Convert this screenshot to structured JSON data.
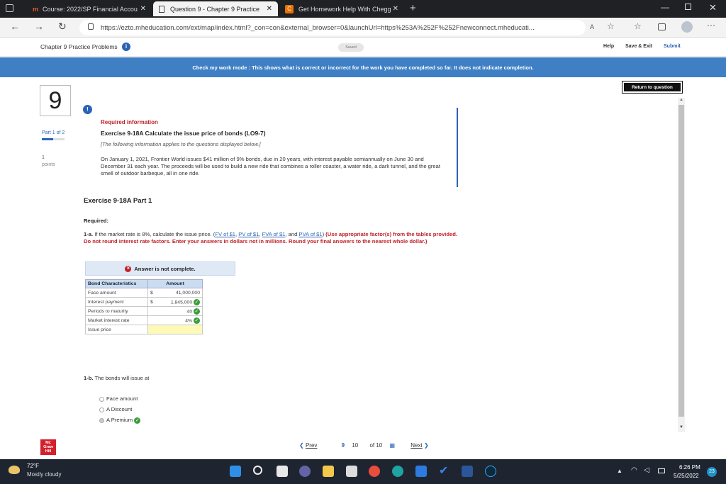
{
  "browser": {
    "tabs": [
      {
        "label": "Course: 2022/SP Financial Accou",
        "icon": "mheducation-icon"
      },
      {
        "label": "Question 9 - Chapter 9 Practice",
        "icon": "page-icon"
      },
      {
        "label": "Get Homework Help With Chegg",
        "icon": "chegg-icon"
      }
    ],
    "url": "https://ezto.mheducation.com/ext/map/index.html?_con=con&external_browser=0&launchUrl=https%253A%252F%252Fnewconnect.mheducati..."
  },
  "header": {
    "title": "Chapter 9 Practice Problems",
    "saved": "Saved",
    "help": "Help",
    "save_exit": "Save & Exit",
    "submit": "Submit"
  },
  "banner": "Check my work mode : This shows what is correct or incorrect for the work you have completed so far. It does not indicate completion.",
  "return_button": "Return to question",
  "question": {
    "number": "9",
    "part": "Part 1 of 2",
    "points_value": "1",
    "points_label": "points",
    "required_info": "Required information",
    "exercise_title": "Exercise 9-18A Calculate the issue price of bonds (LO9-7)",
    "note": "[The following information applies to the questions displayed below.]",
    "scenario": "On January 1, 2021, Frontier World issues $41 million of 9% bonds, due in 20 years, with interest payable semiannually on June 30 and December 31 each year. The proceeds will be used to build a new ride that combines a roller coaster, a water ride, a dark tunnel, and the great smell of outdoor barbeque, all in one ride.",
    "part_title": "Exercise 9-18A Part 1",
    "required": "Required:",
    "q1a_prefix": "1-a.",
    "q1a_text": "If the market rate is 8%, calculate the issue price.",
    "links": [
      "FV of $1",
      "PV of $1",
      "FVA of $1",
      "PVA of $1"
    ],
    "q1a_instr": "(Use appropriate factor(s) from the tables provided. Do not round interest rate factors. Enter your answers in dollars not in millions. Round your final answers to the nearest whole dollar.)",
    "answer_status": "Answer is not complete.",
    "table": {
      "headers": [
        "Bond Characteristics",
        "Amount"
      ],
      "rows": [
        {
          "label": "Face amount",
          "currency": "$",
          "value": "41,000,000",
          "correct": false
        },
        {
          "label": "Interest payment",
          "currency": "$",
          "value": "1,845,000",
          "correct": true
        },
        {
          "label": "Periods to maturity",
          "currency": "",
          "value": "40",
          "correct": true
        },
        {
          "label": "Market interest rate",
          "currency": "",
          "value": "4%",
          "correct": true
        },
        {
          "label": "Issue price",
          "currency": "",
          "value": "",
          "correct": false
        }
      ]
    },
    "q1b_prefix": "1-b.",
    "q1b_text": "The bonds will issue at",
    "options": [
      "Face amount",
      "A Discount",
      "A Premium"
    ]
  },
  "footer": {
    "prev": "Prev",
    "current": "9",
    "next_num": "10",
    "of": "of 10",
    "next": "Next"
  },
  "taskbar": {
    "temp": "72°F",
    "weather": "Mostly cloudy",
    "time": "6:26 PM",
    "date": "5/25/2022",
    "notif": "23"
  },
  "colors": {
    "banner": "#3f7fc4",
    "accent": "#2a63b8",
    "red": "#c0222a",
    "green": "#3a9d3a"
  }
}
